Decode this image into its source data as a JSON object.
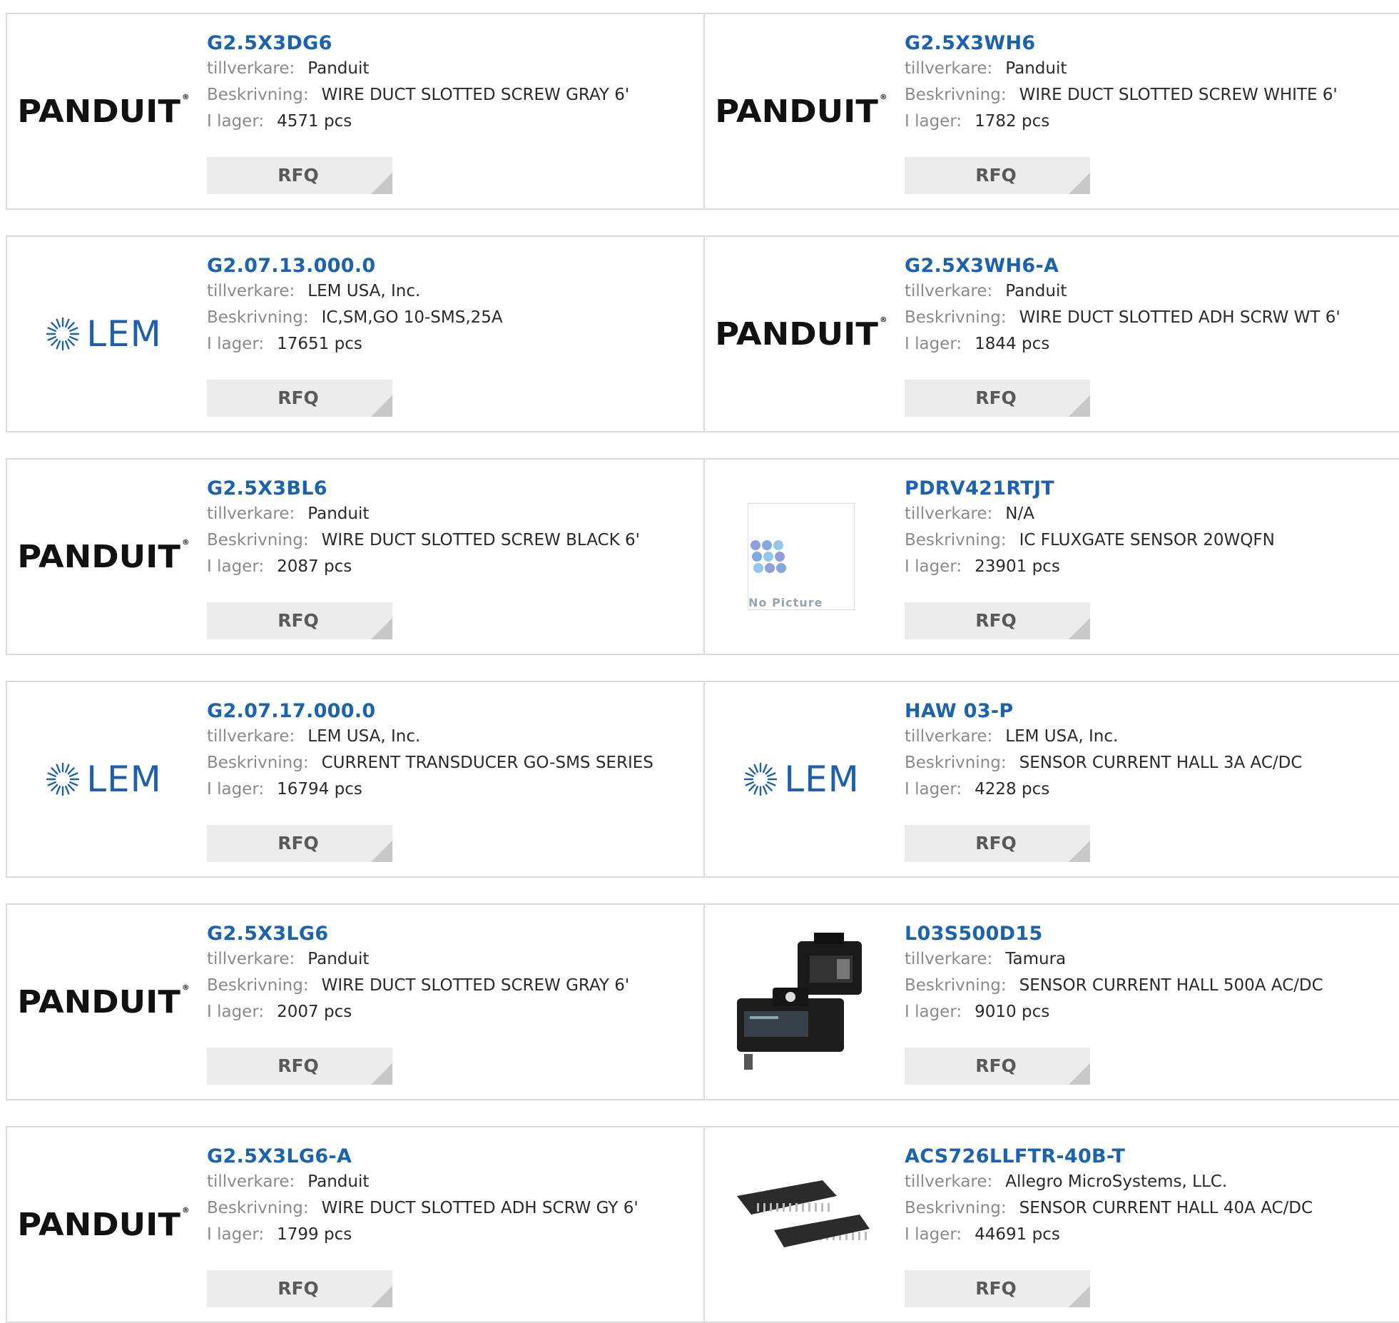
{
  "labels": {
    "manufacturer": "tillverkare:",
    "description": "Beskrivning:",
    "stock": "I lager:",
    "rfq": "RFQ",
    "no_picture": "No Picture"
  },
  "brands": {
    "panduit": "PANDUIT",
    "lem": "LEM"
  },
  "colors": {
    "link": "#1b63ae",
    "label": "#8a8a8a",
    "button_bg": "#ececec",
    "button_corner": "#c8c8c8",
    "border": "#dcdcdc",
    "lem_blue": "#1f5fae"
  },
  "products": [
    {
      "part": "G2.5X3DG6",
      "manufacturer": "Panduit",
      "description": "WIRE DUCT SLOTTED SCREW GRAY 6'",
      "stock": "4571 pcs",
      "logo": "panduit"
    },
    {
      "part": "G2.5X3WH6",
      "manufacturer": "Panduit",
      "description": "WIRE DUCT SLOTTED SCREW WHITE 6'",
      "stock": "1782 pcs",
      "logo": "panduit"
    },
    {
      "part": "G2.07.13.000.0",
      "manufacturer": "LEM USA, Inc.",
      "description": "IC,SM,GO 10-SMS,25A",
      "stock": "17651 pcs",
      "logo": "lem"
    },
    {
      "part": "G2.5X3WH6-A",
      "manufacturer": "Panduit",
      "description": "WIRE DUCT SLOTTED ADH SCRW WT 6'",
      "stock": "1844 pcs",
      "logo": "panduit"
    },
    {
      "part": "G2.5X3BL6",
      "manufacturer": "Panduit",
      "description": "WIRE DUCT SLOTTED SCREW BLACK 6'",
      "stock": "2087 pcs",
      "logo": "panduit"
    },
    {
      "part": "PDRV421RTJT",
      "manufacturer": "N/A",
      "description": "IC FLUXGATE SENSOR 20WQFN",
      "stock": "23901 pcs",
      "logo": "nopic"
    },
    {
      "part": "G2.07.17.000.0",
      "manufacturer": "LEM USA, Inc.",
      "description": "CURRENT TRANSDUCER GO-SMS SERIES",
      "stock": "16794 pcs",
      "logo": "lem"
    },
    {
      "part": "HAW 03-P",
      "manufacturer": "LEM USA, Inc.",
      "description": "SENSOR CURRENT HALL 3A AC/DC",
      "stock": "4228 pcs",
      "logo": "lem"
    },
    {
      "part": "G2.5X3LG6",
      "manufacturer": "Panduit",
      "description": "WIRE DUCT SLOTTED SCREW GRAY 6'",
      "stock": "2007 pcs",
      "logo": "panduit"
    },
    {
      "part": "L03S500D15",
      "manufacturer": "Tamura",
      "description": "SENSOR CURRENT HALL 500A AC/DC",
      "stock": "9010 pcs",
      "logo": "sensor"
    },
    {
      "part": "G2.5X3LG6-A",
      "manufacturer": "Panduit",
      "description": "WIRE DUCT SLOTTED ADH SCRW GY 6'",
      "stock": "1799 pcs",
      "logo": "panduit"
    },
    {
      "part": "ACS726LLFTR-40B-T",
      "manufacturer": "Allegro MicroSystems, LLC.",
      "description": "SENSOR CURRENT HALL 40A AC/DC",
      "stock": "44691 pcs",
      "logo": "chip"
    }
  ]
}
